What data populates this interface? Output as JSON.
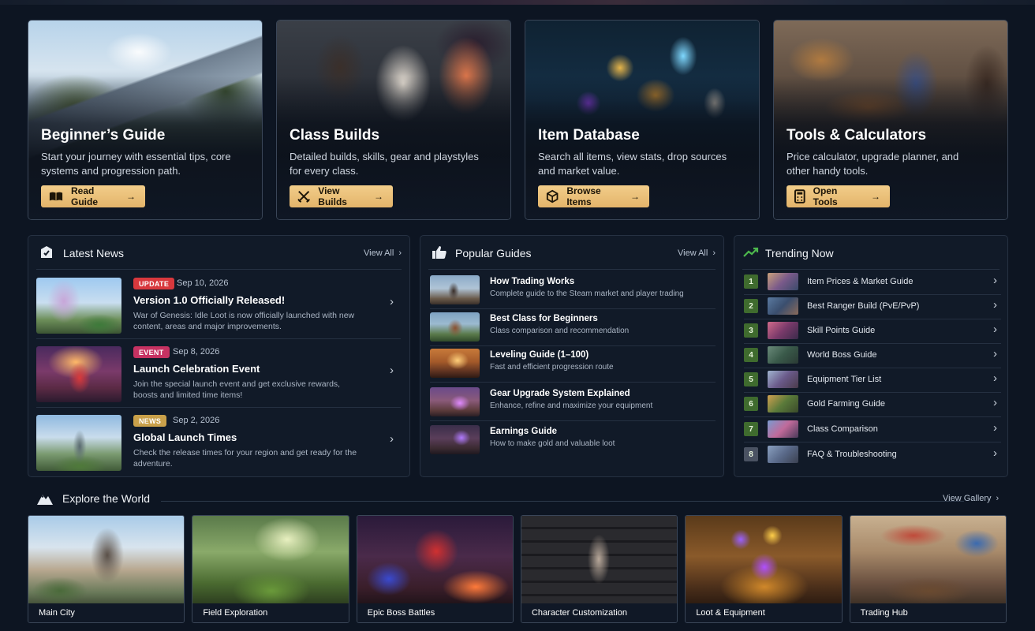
{
  "features": [
    {
      "title": "Beginner’s Guide",
      "desc": "Start your journey with essential tips, core systems and progression path.",
      "button": "Read Guide"
    },
    {
      "title": "Class Builds",
      "desc": "Detailed builds, skills, gear and playstyles for every class.",
      "button": "View Builds"
    },
    {
      "title": "Item Database",
      "desc": "Search all items, view stats, drop sources and market value.",
      "button": "Browse Items"
    },
    {
      "title": "Tools & Calculators",
      "desc": "Price calculator, upgrade planner, and other handy tools.",
      "button": "Open Tools"
    }
  ],
  "news": {
    "title": "Latest News",
    "view_all": "View All",
    "items": [
      {
        "badge": "UPDATE",
        "badge_color": "#d8383d",
        "date": "Sep 10, 2026",
        "title": "Version 1.0 Officially Released!",
        "desc": "War of Genesis: Idle Loot is now officially launched with new content, areas and major improvements."
      },
      {
        "badge": "EVENT",
        "badge_color": "#c63262",
        "date": "Sep 8, 2026",
        "title": "Launch Celebration Event",
        "desc": "Join the special launch event and get exclusive rewards, boosts and limited time items!"
      },
      {
        "badge": "NEWS",
        "badge_color": "#c9a04a",
        "date": "Sep 2, 2026",
        "title": "Global Launch Times",
        "desc": "Check the release times for your region and get ready for the adventure."
      }
    ]
  },
  "guides": {
    "title": "Popular Guides",
    "view_all": "View All",
    "items": [
      {
        "title": "How Trading Works",
        "desc": "Complete guide to the Steam market and player trading"
      },
      {
        "title": "Best Class for Beginners",
        "desc": "Class comparison and recommendation"
      },
      {
        "title": "Leveling Guide (1–100)",
        "desc": "Fast and efficient progression route"
      },
      {
        "title": "Gear Upgrade System Explained",
        "desc": "Enhance, refine and maximize your equipment"
      },
      {
        "title": "Earnings Guide",
        "desc": "How to make gold and valuable loot"
      }
    ]
  },
  "trending": {
    "title": "Trending Now",
    "items": [
      {
        "rank": "1",
        "label": "Item Prices & Market Guide"
      },
      {
        "rank": "2",
        "label": "Best Ranger Build (PvE/PvP)"
      },
      {
        "rank": "3",
        "label": "Skill Points Guide"
      },
      {
        "rank": "4",
        "label": "World Boss Guide"
      },
      {
        "rank": "5",
        "label": "Equipment Tier List"
      },
      {
        "rank": "6",
        "label": "Gold Farming Guide"
      },
      {
        "rank": "7",
        "label": "Class Comparison"
      },
      {
        "rank": "8",
        "label": "FAQ & Troubleshooting"
      }
    ]
  },
  "explore": {
    "title": "Explore the World",
    "view_gallery": "View Gallery",
    "items": [
      {
        "label": "Main City"
      },
      {
        "label": "Field Exploration"
      },
      {
        "label": "Epic Boss Battles"
      },
      {
        "label": "Character Customization"
      },
      {
        "label": "Loot & Equipment"
      },
      {
        "label": "Trading Hub"
      }
    ]
  },
  "colors": {
    "accent": "#e9bd72",
    "rank_green": "#3f6b2e",
    "background": "#0d1522"
  }
}
